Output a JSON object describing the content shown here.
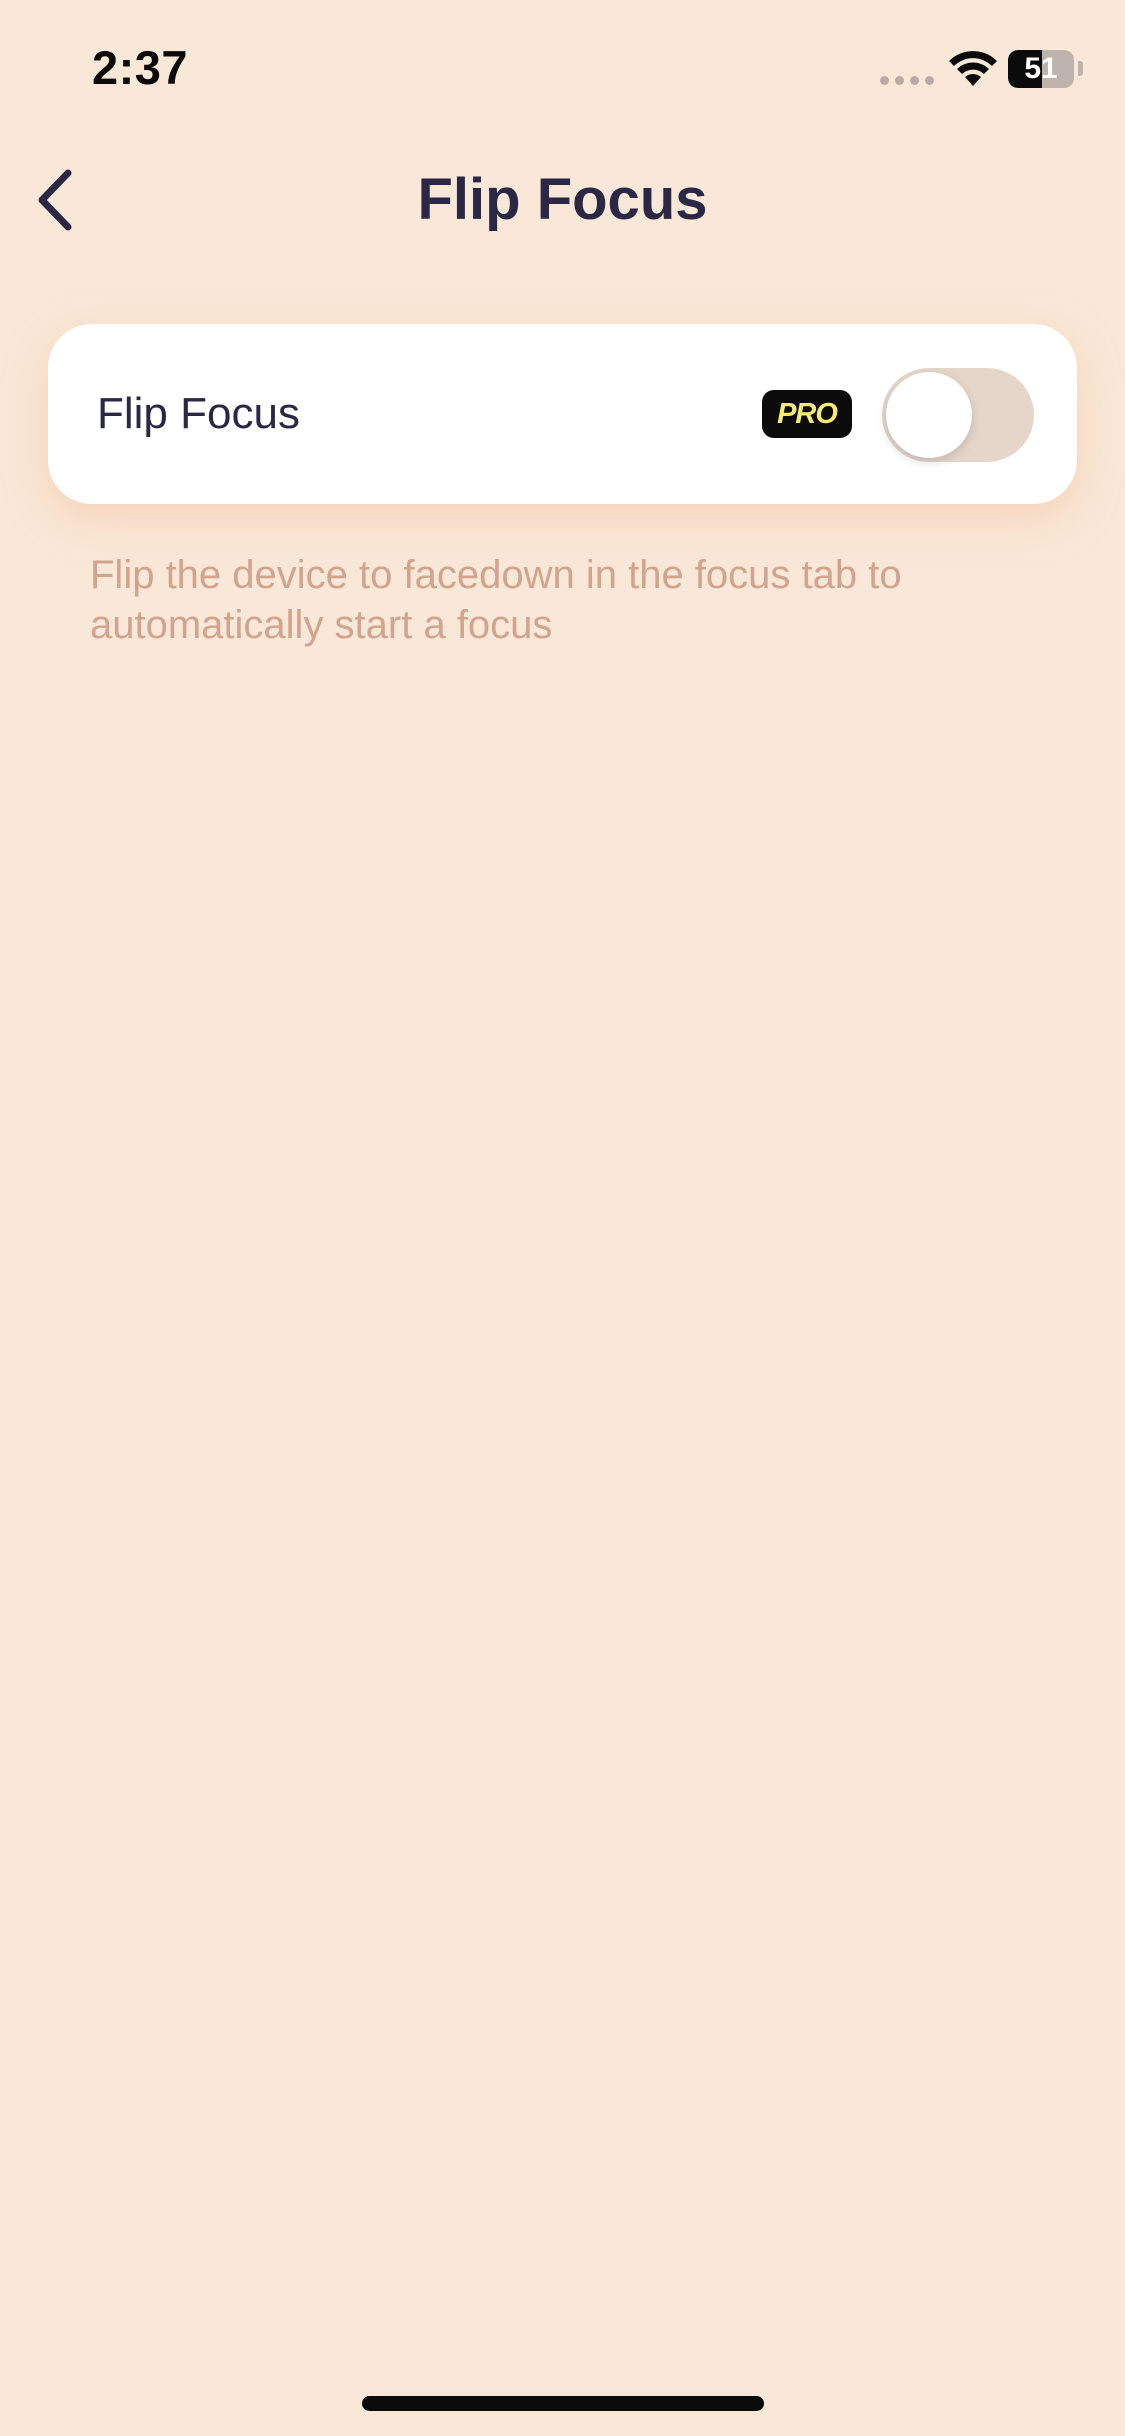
{
  "status_bar": {
    "time": "2:37",
    "battery_level": "51",
    "battery_fraction": 0.51,
    "signal_icon": "cellular-signal-dots",
    "wifi_icon": "wifi-icon"
  },
  "nav": {
    "back_icon": "chevron-left-icon",
    "title": "Flip Focus"
  },
  "setting": {
    "label": "Flip Focus",
    "badge": "PRO",
    "toggle_on": false
  },
  "description": "Flip the device to facedown in the focus tab to automatically start a focus",
  "colors": {
    "background": "#F9E7D7",
    "title_text": "#2B2846",
    "description_text": "#D2A48E",
    "card": "#FFFFFF",
    "toggle_off": "#E6D6CA",
    "badge_bg": "#0B0B0B",
    "badge_text": "#F7EC6E"
  }
}
